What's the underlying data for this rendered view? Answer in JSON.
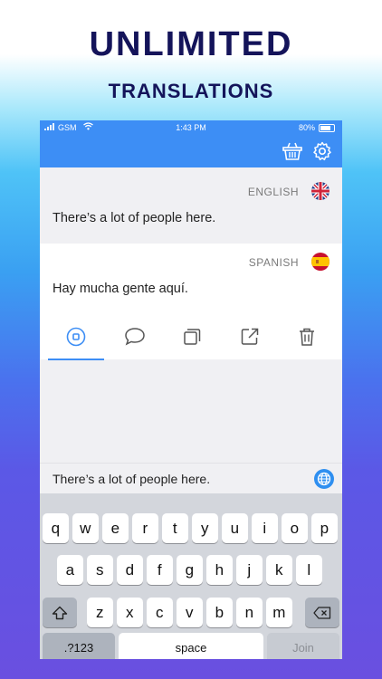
{
  "headline": {
    "line1": "UNLIMITED",
    "line2": "TRANSLATIONS"
  },
  "status_bar": {
    "carrier": "GSM",
    "time": "1:43 PM",
    "battery": "80%"
  },
  "navbar": {
    "icons": [
      "basket-icon",
      "gear-icon"
    ]
  },
  "source": {
    "language": "ENGLISH",
    "text": "There’s a lot of people here.",
    "flag": "uk-flag-icon"
  },
  "target": {
    "language": "SPANISH",
    "text": "Hay mucha gente aquí.",
    "flag": "spain-flag-icon"
  },
  "actions": [
    "speak-icon",
    "chat-icon",
    "copy-icon",
    "share-icon",
    "trash-icon"
  ],
  "input": {
    "value": "There’s a lot of people here."
  },
  "keyboard": {
    "row1": [
      "q",
      "w",
      "e",
      "r",
      "t",
      "y",
      "u",
      "i",
      "o",
      "p"
    ],
    "row2": [
      "a",
      "s",
      "d",
      "f",
      "g",
      "h",
      "j",
      "k",
      "l"
    ],
    "row3": [
      "z",
      "x",
      "c",
      "v",
      "b",
      "n",
      "m"
    ],
    "numbers_label": ".?123",
    "space_label": "space",
    "join_label": "Join"
  },
  "colors": {
    "accent": "#3d8ef5",
    "headline": "#14145a"
  }
}
